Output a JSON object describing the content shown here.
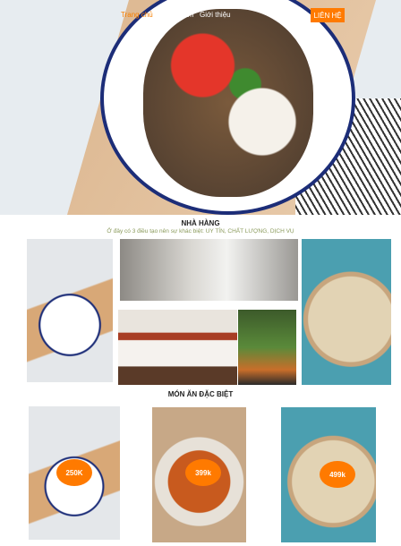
{
  "nav": {
    "items": [
      "Trang chủ",
      "Sản phẩm",
      "Giới thiệu"
    ],
    "cta": "LIÊN HỆ"
  },
  "about": {
    "title": "NHÀ HÀNG",
    "subtitle": "Ở đây có 3 điều tạo nên sự khác biệt: UY TÍN, CHẤT LƯỢNG, DỊCH VỤ"
  },
  "specials": {
    "title": "MÓN ĂN ĐẶC BIỆT",
    "items": [
      {
        "price": "250K"
      },
      {
        "price": "399k"
      },
      {
        "price": "499k"
      }
    ]
  },
  "colors": {
    "accent": "#ff7a00",
    "subtitle": "#8a9a5b"
  }
}
